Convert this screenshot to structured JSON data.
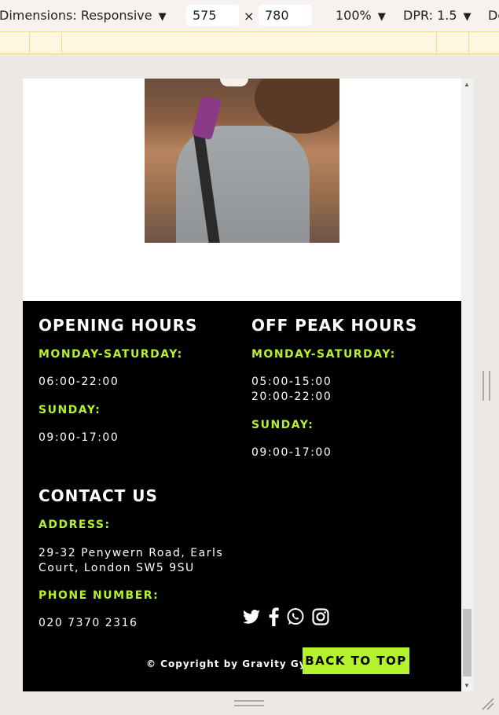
{
  "toolbar": {
    "dimensions_label": "Dimensions: Responsive",
    "width_value": "575",
    "times": "×",
    "height_value": "780",
    "zoom_label": "100%",
    "dpr_label": "DPR: 1.5",
    "more_label": "De"
  },
  "footer": {
    "opening_title": "OPENING HOURS",
    "opening_weekday_label": "MONDAY-SATURDAY:",
    "opening_weekday_hours": "06:00-22:00",
    "opening_sunday_label": "SUNDAY:",
    "opening_sunday_hours": "09:00-17:00",
    "offpeak_title": "OFF PEAK HOURS",
    "offpeak_weekday_label": "MONDAY-SATURDAY:",
    "offpeak_weekday_hours": "05:00-15:00\n20:00-22:00",
    "offpeak_sunday_label": "SUNDAY:",
    "offpeak_sunday_hours": "09:00-17:00",
    "contact_title": "CONTACT US",
    "address_label": "ADDRESS:",
    "address_value": "29-32 Penywern Road, Earls\nCourt, London SW5 9SU",
    "phone_label": "PHONE NUMBER:",
    "phone_value": "020 7370 2316",
    "copyright": "© Copyright by Gravity Gym",
    "back_to_top": "BACK TO TOP"
  },
  "socials": [
    "twitter-icon",
    "facebook-icon",
    "whatsapp-icon",
    "instagram-icon"
  ],
  "colors": {
    "accent": "#b3f22c",
    "footer_bg": "#000000"
  }
}
